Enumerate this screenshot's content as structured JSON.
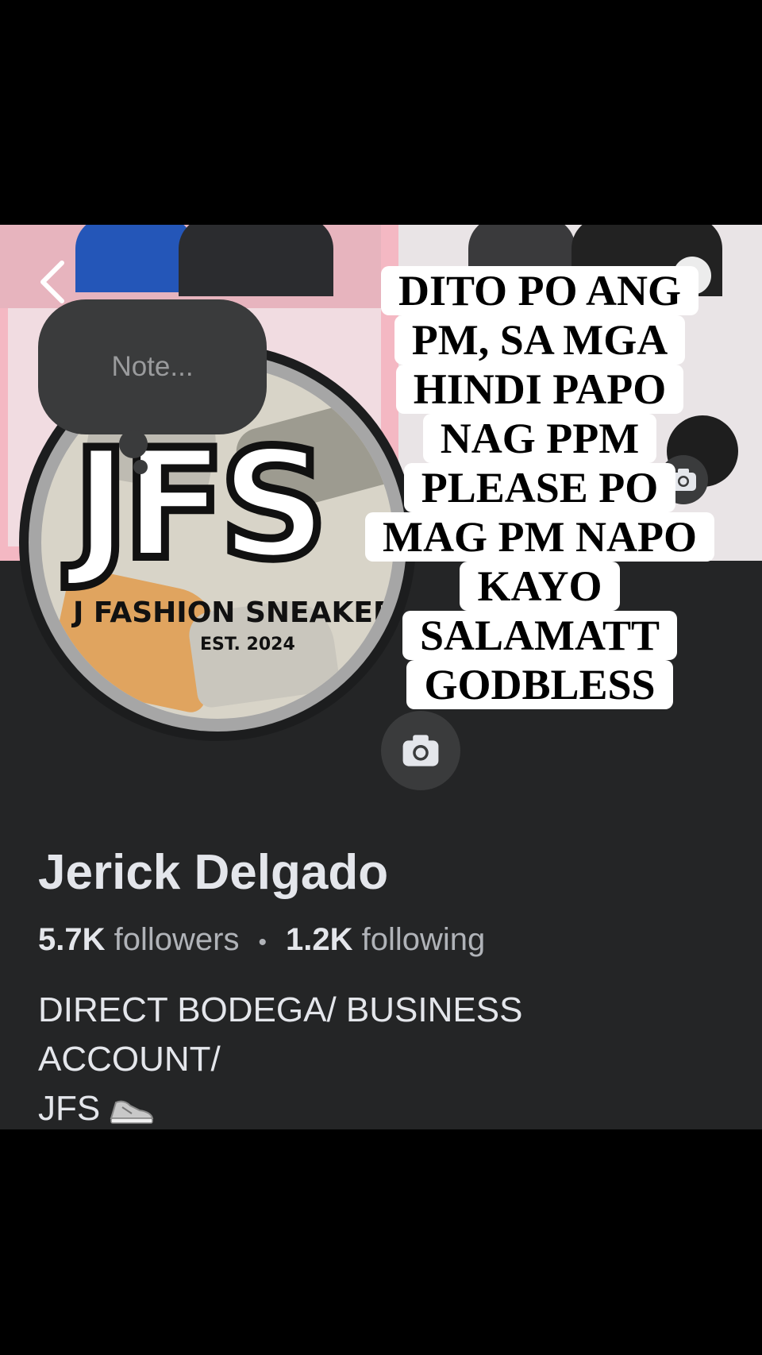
{
  "note": {
    "placeholder": "Note..."
  },
  "caption": {
    "lines": [
      "DITO PO ANG",
      "PM, SA MGA",
      "HINDI PAPO",
      "NAG PPM",
      "PLEASE PO",
      "MAG PM NAPO",
      "KAYO",
      "SALAMATT",
      "GODBLESS"
    ]
  },
  "avatar_logo": {
    "monogram": "JFS",
    "brand": "J FASHION SNEAKERS",
    "established": "EST. 2024"
  },
  "profile": {
    "name": "Jerick Delgado",
    "followers_count": "5.7K",
    "followers_label": "followers",
    "separator": "•",
    "following_count": "1.2K",
    "following_label": "following",
    "bio": [
      "DIRECT BODEGA/ BUSINESS",
      "ACCOUNT/",
      "JFS"
    ]
  },
  "icons": {
    "back": "chevron-left-icon",
    "camera": "camera-icon",
    "sneaker": "sneaker-emoji-icon"
  },
  "colors": {
    "background": "#242526",
    "text_primary": "#e4e6eb",
    "text_secondary": "#b0b3b8",
    "bubble": "#3a3b3c"
  }
}
